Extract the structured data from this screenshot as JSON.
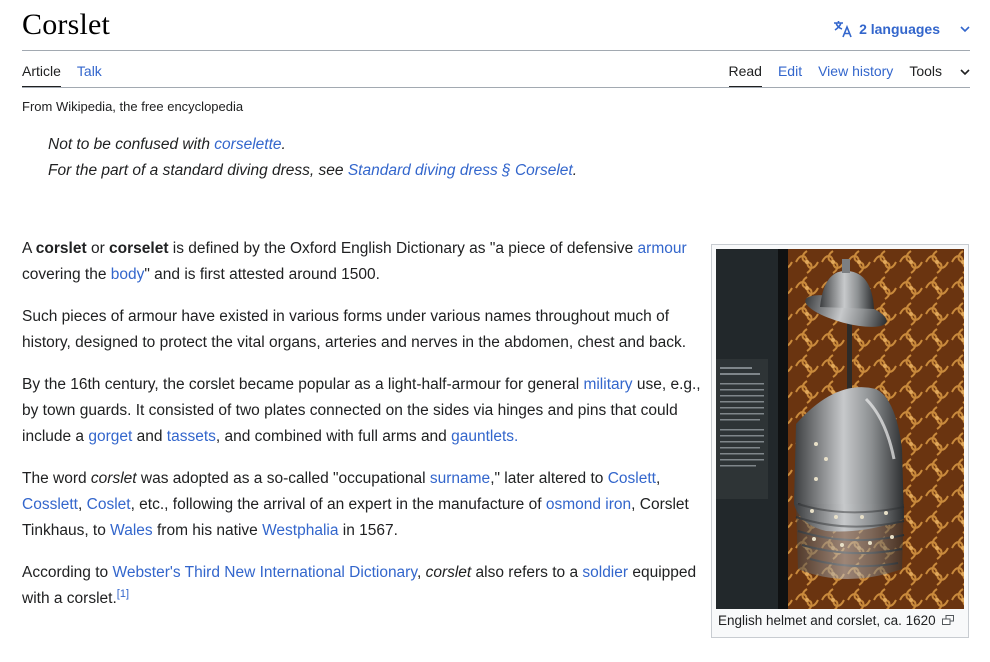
{
  "page": {
    "title": "Corslet",
    "tagline": "From Wikipedia, the free encyclopedia"
  },
  "lang": {
    "label": "2 languages"
  },
  "tabs": {
    "article": "Article",
    "talk": "Talk",
    "read": "Read",
    "edit": "Edit",
    "history": "View history",
    "tools": "Tools"
  },
  "hatnotes": {
    "h1": {
      "pre": "Not to be confused with ",
      "link": "corselette",
      "post": "."
    },
    "h2": {
      "pre": "For the part of a standard diving dress, see ",
      "link": "Standard diving dress § Corselet",
      "post": "."
    }
  },
  "p1": {
    "a": "A ",
    "b1": "corslet",
    "c": " or ",
    "b2": "corselet",
    "d": " is defined by the Oxford English Dictionary as \"a piece of defensive ",
    "l1": "armour",
    "e": " covering the ",
    "l2": "body",
    "f": "\" and is first attested around 1500."
  },
  "p2": {
    "text": "Such pieces of armour have existed in various forms under various names throughout much of history, designed to protect the vital organs, arteries and nerves in the abdomen, chest and back."
  },
  "p3": {
    "a": "By the 16th century, the corslet became popular as a light-half-armour for general ",
    "l1": "military",
    "b": " use, e.g., by town guards. It consisted of two plates connected on the sides via hinges and pins that could include a ",
    "l2": "gorget",
    "c": " and ",
    "l3": "tassets",
    "d": ", and combined with full arms and ",
    "l4": "gauntlets",
    "e": "."
  },
  "p4": {
    "a": "The word ",
    "i1": "corslet",
    "b": " was adopted as a so-called \"occupational ",
    "l1": "surname",
    "c": ",\" later altered to ",
    "l2": "Coslett",
    "d": ", ",
    "l3": "Cosslett",
    "e": ", ",
    "l4": "Coslet",
    "f": ", etc., following the arrival of an expert in the manufacture of ",
    "l5": "osmond iron",
    "g": ", Corslet Tinkhaus, to ",
    "l6": "Wales",
    "h": " from his native ",
    "l7": "Westphalia",
    "i": " in 1567."
  },
  "p5": {
    "a": "According to ",
    "l1": "Webster's Third New International Dictionary",
    "b": ", ",
    "i1": "corslet",
    "c": " also refers to a ",
    "l2": "soldier",
    "d": " equipped with a corslet.",
    "ref": "[1]"
  },
  "figure": {
    "caption": "English helmet and corslet, ca. 1620"
  }
}
